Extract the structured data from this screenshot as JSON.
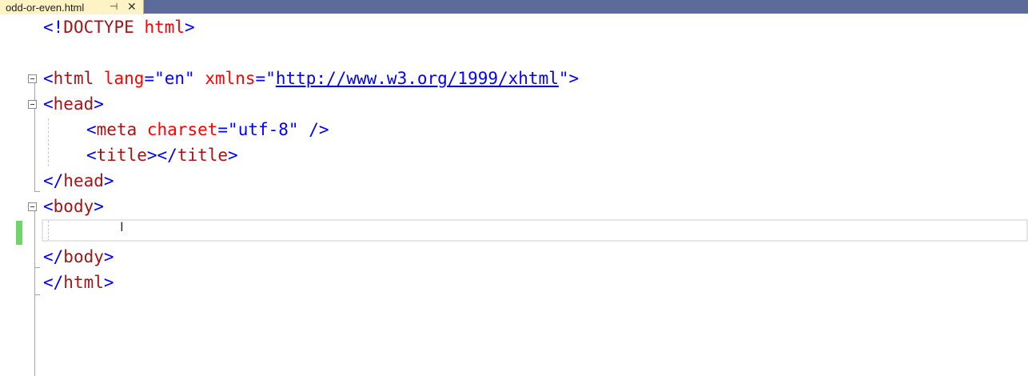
{
  "tab": {
    "filename": "odd-or-even.html",
    "pin_glyph": "⊣",
    "close_glyph": "✕"
  },
  "code": {
    "doctype": {
      "open": "<!",
      "keyword": "DOCTYPE",
      "name": " html",
      "close": ">"
    },
    "html_open": {
      "lt": "<",
      "tag": "html",
      "attr1": " lang",
      "eq1": "=",
      "val1": "\"en\"",
      "attr2": " xmlns",
      "eq2": "=",
      "q1": "\"",
      "url": "http://www.w3.org/1999/xhtml",
      "q2": "\"",
      "gt": ">"
    },
    "head_open": {
      "lt": "<",
      "tag": "head",
      "gt": ">"
    },
    "meta": {
      "lt": "<",
      "tag": "meta",
      "attr": " charset",
      "eq": "=",
      "val": "\"utf-8\"",
      "end": " />"
    },
    "title": {
      "lt": "<",
      "tag": "title",
      "mid": "></",
      "tag2": "title",
      "gt": ">"
    },
    "head_close": {
      "lt": "</",
      "tag": "head",
      "gt": ">"
    },
    "body_open": {
      "lt": "<",
      "tag": "body",
      "gt": ">"
    },
    "body_close": {
      "lt": "</",
      "tag": "body",
      "gt": ">"
    },
    "html_close": {
      "lt": "</",
      "tag": "html",
      "gt": ">"
    }
  },
  "colors": {
    "tabbar": "#5c6b99",
    "tab_active": "#fdf3c5",
    "tag_delim": "#0000ff",
    "tag_name": "#a31515",
    "attribute": "#ff0000",
    "change_marker": "#6fd46a"
  },
  "icons": [
    "pin-icon",
    "close-icon",
    "collapse-icon",
    "ibeam-cursor-icon"
  ]
}
